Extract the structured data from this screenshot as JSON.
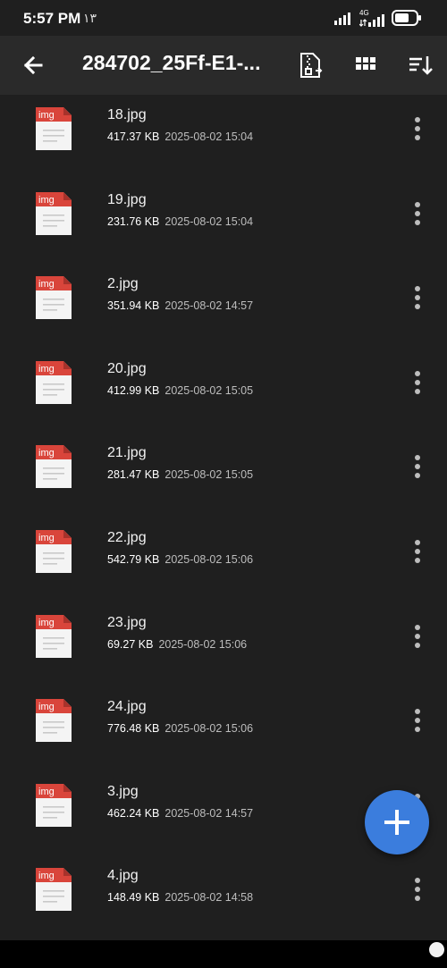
{
  "status_bar": {
    "time": "5:57 PM",
    "extra": "١٣",
    "network_label": "4G"
  },
  "app_bar": {
    "title": "284702_25Ff-E1-...",
    "back_icon": "arrow-left-icon",
    "actions": [
      {
        "name": "zip-archive-icon"
      },
      {
        "name": "grid-view-icon"
      },
      {
        "name": "sort-icon"
      }
    ]
  },
  "colors": {
    "background": "#1f1f1f",
    "app_bar": "#2a2a2a",
    "icon_red": "#d9453b",
    "fab": "#3b7ddd"
  },
  "files": [
    {
      "name": "18.jpg",
      "size": "417.37 KB",
      "date": "2025-08-02 15:04",
      "badge": "img"
    },
    {
      "name": "19.jpg",
      "size": "231.76 KB",
      "date": "2025-08-02 15:04",
      "badge": "img"
    },
    {
      "name": "2.jpg",
      "size": "351.94 KB",
      "date": "2025-08-02 14:57",
      "badge": "img"
    },
    {
      "name": "20.jpg",
      "size": "412.99 KB",
      "date": "2025-08-02 15:05",
      "badge": "img"
    },
    {
      "name": "21.jpg",
      "size": "281.47 KB",
      "date": "2025-08-02 15:05",
      "badge": "img"
    },
    {
      "name": "22.jpg",
      "size": "542.79 KB",
      "date": "2025-08-02 15:06",
      "badge": "img"
    },
    {
      "name": "23.jpg",
      "size": "69.27 KB",
      "date": "2025-08-02 15:06",
      "badge": "img"
    },
    {
      "name": "24.jpg",
      "size": "776.48 KB",
      "date": "2025-08-02 15:06",
      "badge": "img"
    },
    {
      "name": "3.jpg",
      "size": "462.24 KB",
      "date": "2025-08-02 14:57",
      "badge": "img"
    },
    {
      "name": "4.jpg",
      "size": "148.49 KB",
      "date": "2025-08-02 14:58",
      "badge": "img"
    }
  ],
  "fab": {
    "icon": "plus-icon"
  }
}
